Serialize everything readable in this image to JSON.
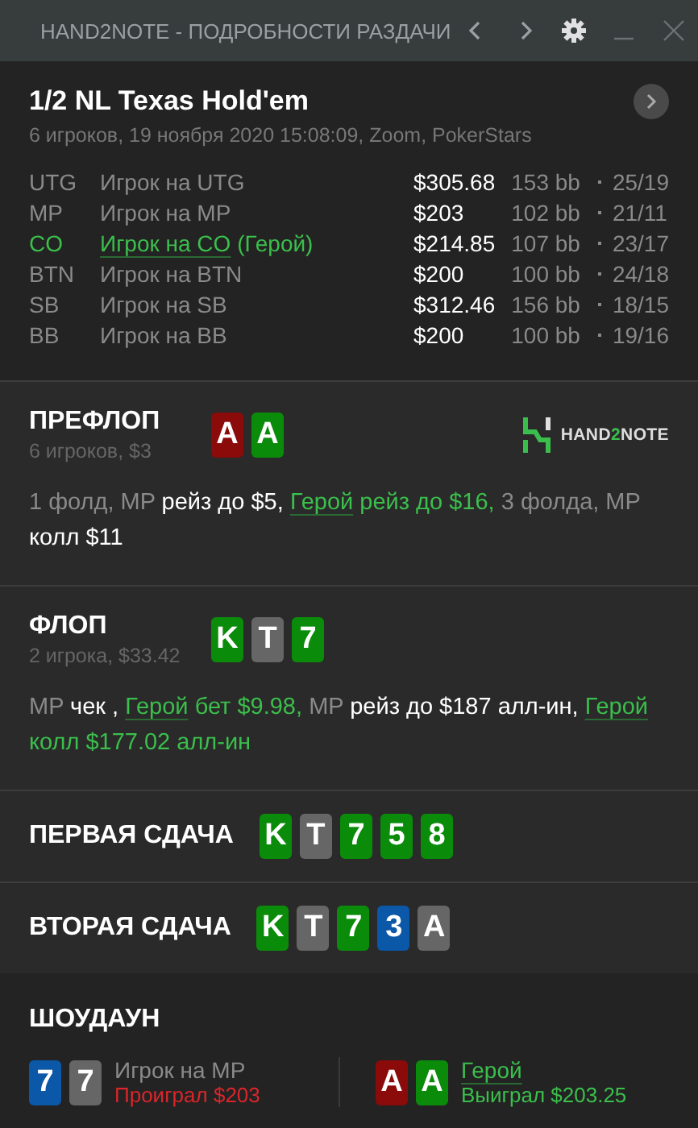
{
  "window": {
    "title": "HAND2NOTE - ПОДРОБНОСТИ РАЗДАЧИ"
  },
  "hand": {
    "title": "1/2 NL Texas Hold'em",
    "subtitle": "6 игроков, 19 ноября 2020 15:08:09, Zoom, PokerStars"
  },
  "players": [
    {
      "position": "UTG",
      "name": "Игрок на UTG",
      "hero": false,
      "stack": "$305.68",
      "bb": "153 bb",
      "stats": "25/19"
    },
    {
      "position": "MP",
      "name": "Игрок на MP",
      "hero": false,
      "stack": "$203",
      "bb": "102 bb",
      "stats": "21/11"
    },
    {
      "position": "CO",
      "name": "Игрок на CO",
      "tag": "(Герой)",
      "hero": true,
      "stack": "$214.85",
      "bb": "107 bb",
      "stats": "23/17"
    },
    {
      "position": "BTN",
      "name": "Игрок на BTN",
      "hero": false,
      "stack": "$200",
      "bb": "100 bb",
      "stats": "24/18"
    },
    {
      "position": "SB",
      "name": "Игрок на SB",
      "hero": false,
      "stack": "$312.46",
      "bb": "156 bb",
      "stats": "18/15"
    },
    {
      "position": "BB",
      "name": "Игрок на BB",
      "hero": false,
      "stack": "$200",
      "bb": "100 bb",
      "stats": "19/16"
    }
  ],
  "streets": [
    {
      "title": "ПРЕФЛОП",
      "subtitle": "6 игроков, $3",
      "logo": {
        "start": "HAND",
        "accent": "2",
        "end": "NOTE"
      },
      "cards": [
        {
          "rank": "A",
          "color": "#8b0a0a"
        },
        {
          "rank": "A",
          "color": "#0a8c0a"
        }
      ],
      "actions": [
        {
          "text": "1 фолд, MP",
          "kind": "muted"
        },
        {
          "text": "рейз до $5,",
          "kind": "action"
        },
        {
          "text": "Герой",
          "kind": "hero-link"
        },
        {
          "text": "рейз до $16,",
          "kind": "hero"
        },
        {
          "text": "3 фолда, MP",
          "kind": "muted"
        },
        {
          "text": "колл $11",
          "kind": "action"
        }
      ]
    },
    {
      "title": "ФЛОП",
      "subtitle": "2 игрока, $33.42",
      "cards": [
        {
          "rank": "K",
          "color": "#0a8c0a"
        },
        {
          "rank": "T",
          "color": "#666666"
        },
        {
          "rank": "7",
          "color": "#0a8c0a"
        }
      ],
      "actions": [
        {
          "text": "MP",
          "kind": "muted"
        },
        {
          "text": "чек ,",
          "kind": "action"
        },
        {
          "text": "Герой",
          "kind": "hero-link"
        },
        {
          "text": "бет $9.98,",
          "kind": "hero"
        },
        {
          "text": "MP",
          "kind": "muted"
        },
        {
          "text": "рейз до $187 алл-ин,",
          "kind": "action"
        },
        {
          "text": "Герой",
          "kind": "hero-link"
        },
        {
          "text": "колл $177.02 алл-ин",
          "kind": "hero"
        }
      ]
    },
    {
      "title": "ПЕРВАЯ СДАЧА",
      "cards": [
        {
          "rank": "K",
          "color": "#0a8c0a"
        },
        {
          "rank": "T",
          "color": "#666666"
        },
        {
          "rank": "7",
          "color": "#0a8c0a"
        },
        {
          "rank": "5",
          "color": "#0a8c0a"
        },
        {
          "rank": "8",
          "color": "#0a8c0a"
        }
      ]
    },
    {
      "title": "ВТОРАЯ СДАЧА",
      "cards": [
        {
          "rank": "K",
          "color": "#0a8c0a"
        },
        {
          "rank": "T",
          "color": "#666666"
        },
        {
          "rank": "7",
          "color": "#0a8c0a"
        },
        {
          "rank": "3",
          "color": "#0b57a8"
        },
        {
          "rank": "A",
          "color": "#666666"
        }
      ]
    }
  ],
  "showdown": {
    "title": "ШОУДАУН",
    "players": [
      {
        "cards": [
          {
            "rank": "7",
            "color": "#0b57a8"
          },
          {
            "rank": "7",
            "color": "#666666"
          }
        ],
        "name": "Игрок на MP",
        "hero": false,
        "result": "Проиграл $203",
        "won": false
      },
      {
        "cards": [
          {
            "rank": "A",
            "color": "#8b0a0a"
          },
          {
            "rank": "A",
            "color": "#0a8c0a"
          }
        ],
        "name": "Герой",
        "hero": true,
        "result": "Выиграл $203.25",
        "won": true
      }
    ]
  }
}
